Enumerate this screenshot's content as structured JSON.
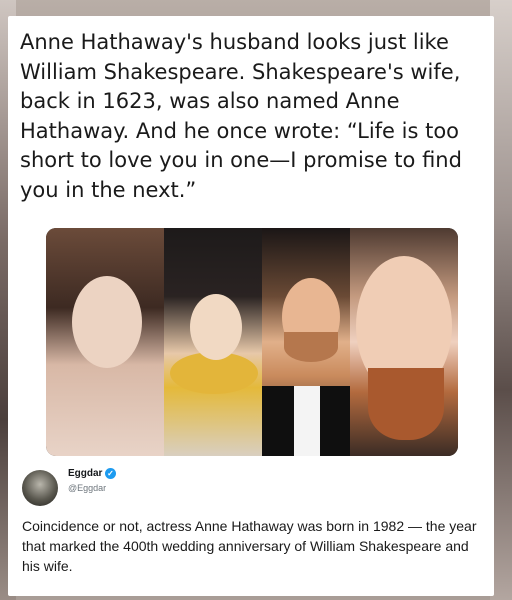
{
  "post": {
    "quote_text": "Anne Hathaway's husband looks just like William Shakespeare. Shakespeare's wife, back in 1623, was also named Anne Hathaway. And he once wrote: “Life is too short to love you in one—I promise to find you in the next.”",
    "collage_panels": [
      "anne-hathaway-photo",
      "anne-hathaway-1623-portrait",
      "husband-photo",
      "william-shakespeare-portrait"
    ]
  },
  "author": {
    "name": "Eggdar",
    "handle": "@Eggdar",
    "verified_icon": "verified-check-icon"
  },
  "caption": "Coincidence or not, actress Anne Hathaway was born in 1982 — the year that marked the 400th wedding anniversary of William Shakespeare and his wife.",
  "colors": {
    "verified": "#1d9bf0",
    "text": "#1a1a1a",
    "handle": "#6e767d"
  }
}
